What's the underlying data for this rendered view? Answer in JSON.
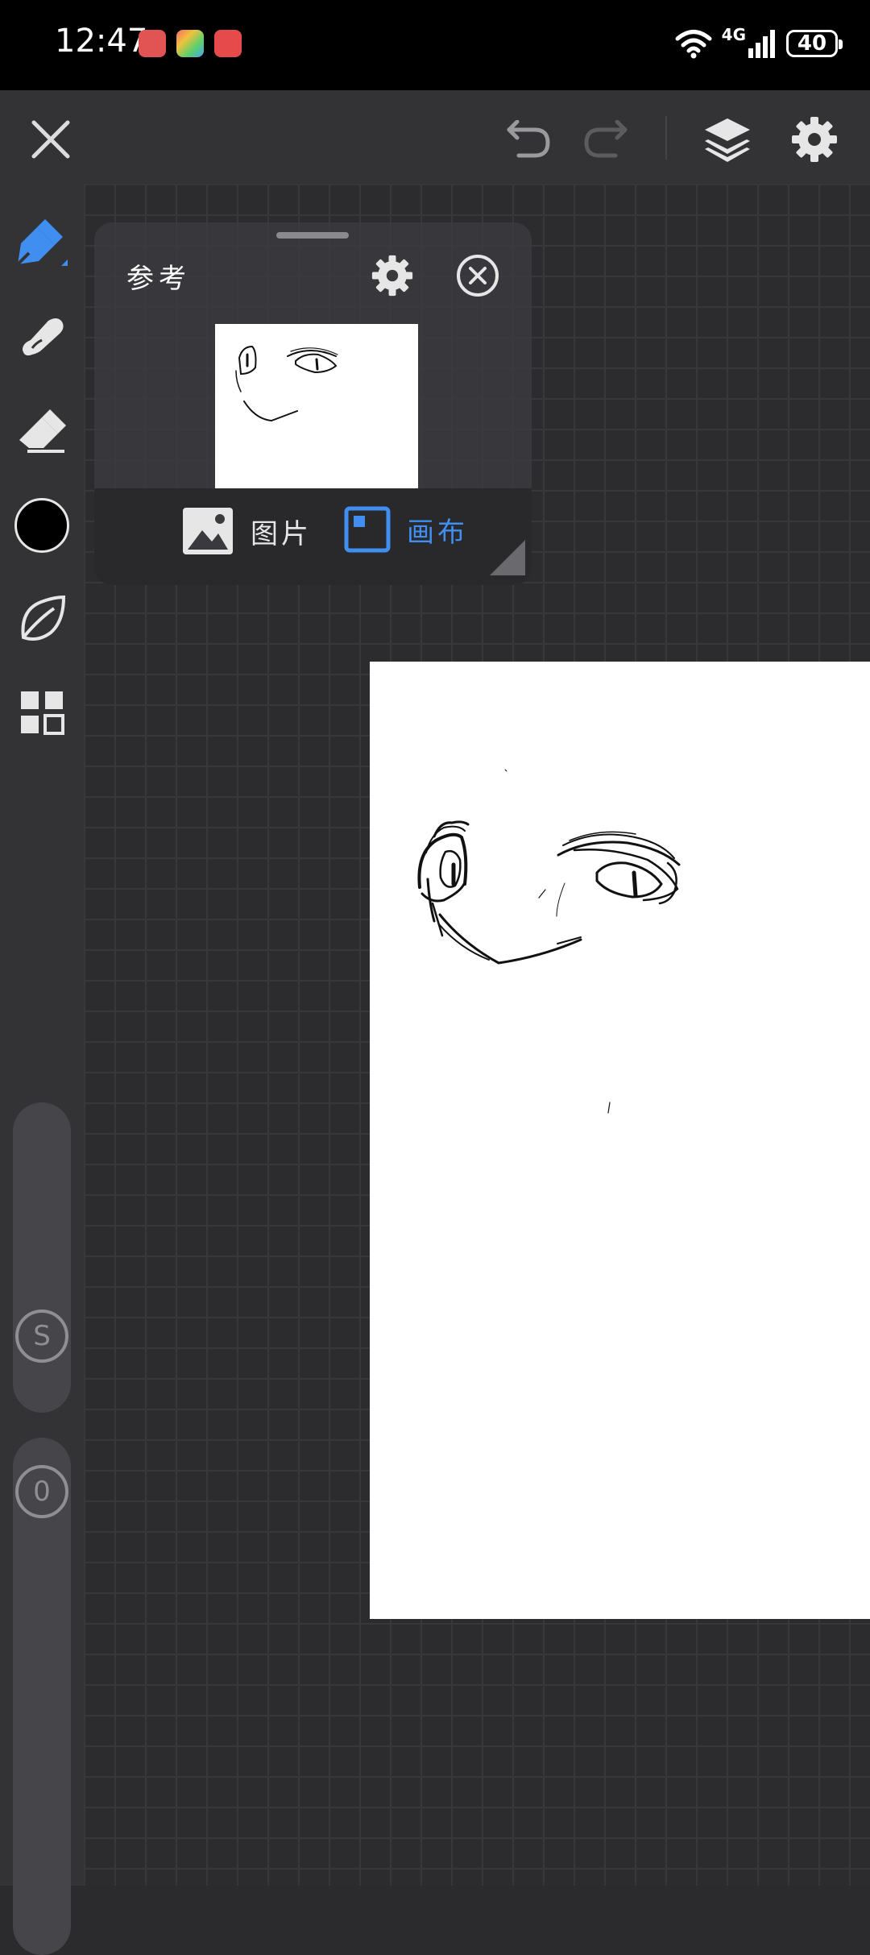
{
  "status_bar": {
    "time": "12:47",
    "apps": [
      {
        "name": "huawei-app-icon",
        "color": "#e25353"
      },
      {
        "name": "multicolor-app-icon",
        "color": "#f1a23b"
      },
      {
        "name": "red-app-icon",
        "color": "#e74a4a"
      }
    ],
    "network": "4G",
    "battery": "40"
  },
  "toolbar": {
    "close_icon": "close-icon",
    "undo_icon": "undo-icon",
    "redo_icon": "redo-icon",
    "layers_icon": "layers-icon",
    "settings_icon": "gear-icon"
  },
  "side_tools": [
    {
      "name": "brush-tool",
      "icon": "brush-icon",
      "active": true
    },
    {
      "name": "smudge-tool",
      "icon": "smudge-icon"
    },
    {
      "name": "eraser-tool",
      "icon": "eraser-icon"
    },
    {
      "name": "color-swatch",
      "icon": "color-icon",
      "color": "#000000"
    },
    {
      "name": "leaf-tool",
      "icon": "leaf-icon"
    },
    {
      "name": "grid-tool",
      "icon": "grid-icon"
    }
  ],
  "sliders": {
    "size_label": "S",
    "opacity_label": "0"
  },
  "reference_panel": {
    "title": "参考",
    "option_image": "图片",
    "option_canvas": "画布",
    "active_option": "canvas",
    "accent_color": "#3f8ef0"
  }
}
